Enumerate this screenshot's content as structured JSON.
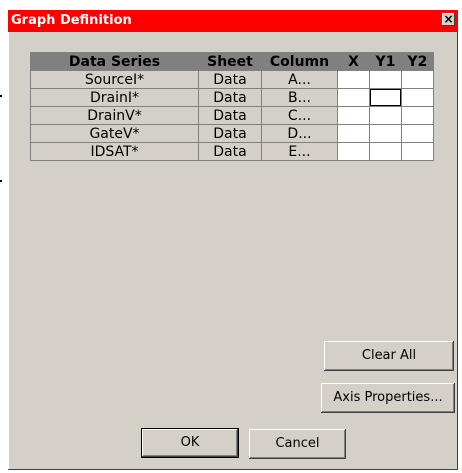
{
  "window": {
    "title": "Graph Definition",
    "close_symbol": "×"
  },
  "table": {
    "headers": [
      "Data Series",
      "Sheet",
      "Column",
      "X",
      "Y1",
      "Y2"
    ],
    "rows": [
      {
        "series": "SourceI*",
        "sheet": "Data",
        "column": "A..."
      },
      {
        "series": "DrainI*",
        "sheet": "Data",
        "column": "B..."
      },
      {
        "series": "DrainV*",
        "sheet": "Data",
        "column": "C..."
      },
      {
        "series": "GateV*",
        "sheet": "Data",
        "column": "D..."
      },
      {
        "series": "IDSAT*",
        "sheet": "Data",
        "column": "E..."
      }
    ]
  },
  "buttons": {
    "clear_all": "Clear All",
    "axis_properties": "Axis Properties...",
    "ok": "OK",
    "cancel": "Cancel"
  },
  "colors": {
    "titlebar": "#ff0000",
    "dialog_bg": "#d4d0c8",
    "header_bg": "#808080"
  }
}
